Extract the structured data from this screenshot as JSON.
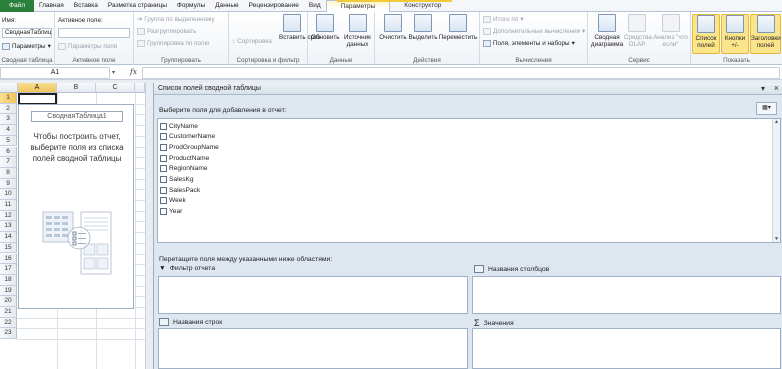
{
  "tabs": [
    "Файл",
    "Главная",
    "Вставка",
    "Разметка страницы",
    "Формулы",
    "Данные",
    "Рецензирование",
    "Вид",
    "Параметры",
    "Конструктор"
  ],
  "ribbon": {
    "pivot_table": {
      "name_label": "Имя:",
      "name_value": "СводнаяТаблица",
      "options_label": "Параметры",
      "group_label": "Сводная таблица"
    },
    "active_field": {
      "label": "Активное поле:",
      "field_settings": "Параметры поля",
      "group_label": "Активное поле"
    },
    "group": {
      "selection": "Группа по выделенному",
      "ungroup": "Разгруппировать",
      "group_field": "Группировка по полю",
      "group_label": "Группировать"
    },
    "sort_filter": {
      "sort": "Сортировка",
      "insert_slicer": "Вставить срез",
      "group_label": "Сортировка и фильтр"
    },
    "data": {
      "refresh": "Обновить",
      "change_source": "Источник данных",
      "group_label": "Данные"
    },
    "actions": {
      "clear": "Очистить",
      "select": "Выделить",
      "move": "Переместить",
      "group_label": "Действия"
    },
    "calculations": {
      "totals": "Итоги по",
      "show_values": "Дополнительные вычисления",
      "fields_items": "Поля, элементы и наборы",
      "group_label": "Вычисления"
    },
    "tools": {
      "pivot_chart": "Сводная диаграмма",
      "olap": "Средства OLAP",
      "what_if": "Анализ \"что если\"",
      "group_label": "Сервис"
    },
    "show": {
      "field_list": "Список полей",
      "buttons": "Кнопки +/-",
      "headers": "Заголовки полей",
      "group_label": "Показать"
    }
  },
  "formula_bar": {
    "name_box": "A1",
    "fx": "fx",
    "value": ""
  },
  "grid": {
    "columns": [
      "A",
      "B",
      "C"
    ],
    "rows": [
      "1",
      "2",
      "3",
      "4",
      "5",
      "6",
      "7",
      "8",
      "9",
      "10",
      "11",
      "12",
      "13",
      "14",
      "15",
      "16",
      "17",
      "18",
      "19",
      "20",
      "21",
      "22",
      "23"
    ],
    "pivot_placeholder_name": "СводнаяТаблица1",
    "pivot_placeholder_msg": "Чтобы построить отчет, выберите поля из списка полей сводной таблицы"
  },
  "field_list": {
    "title": "Список полей сводной таблицы",
    "choose_label": "Выберите поля для добавления в отчет:",
    "fields": [
      "CityName",
      "CustomerName",
      "ProdGroupName",
      "ProductName",
      "RegionName",
      "SalesKg",
      "SalesPack",
      "Week",
      "Year"
    ],
    "drag_label": "Перетащите поля между указанными ниже областями:",
    "areas": {
      "filter": "Фильтр отчета",
      "columns": "Названия столбцов",
      "rows": "Названия строк",
      "values": "Значения"
    },
    "values_icon": "Σ"
  }
}
